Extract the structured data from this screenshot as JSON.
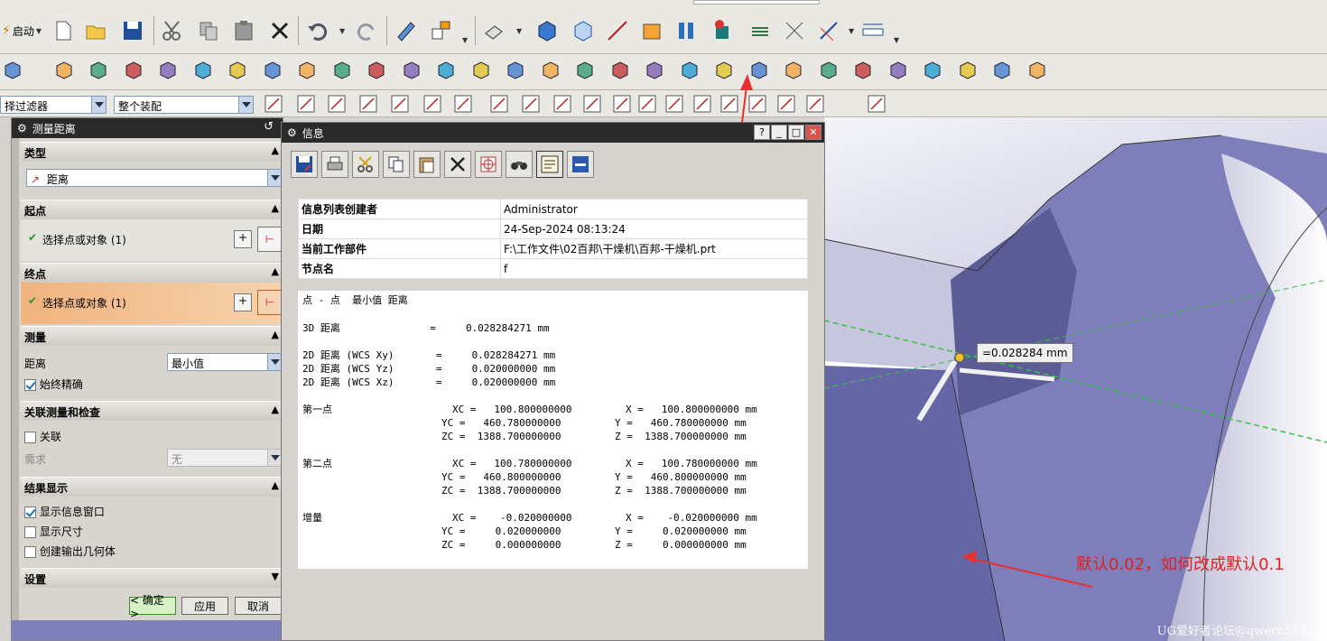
{
  "toolbar": {
    "start_label": "启动",
    "filter_label": "择过滤器",
    "assembly_label": "整个装配"
  },
  "measure_dialog": {
    "title": "测量距离",
    "type_section": "类型",
    "type_value": "距离",
    "start_section": "起点",
    "start_select": "选择点或对象 (1)",
    "end_section": "终点",
    "end_select": "选择点或对象 (1)",
    "measure_section": "测量",
    "distance_label": "距离",
    "distance_value": "最小值",
    "always_accurate": "始终精确",
    "assoc_section": "关联测量和检查",
    "assoc_label": "关联",
    "need_label": "需求",
    "need_value": "无",
    "result_section": "结果显示",
    "show_info": "显示信息窗口",
    "show_dims": "显示尺寸",
    "create_geo": "创建输出几何体",
    "settings_section": "设置",
    "ok_label": "< 确定 >",
    "apply_label": "应用",
    "cancel_label": "取消"
  },
  "info_window": {
    "title": "信息",
    "meta": [
      {
        "key": "信息列表创建者",
        "value": "Administrator"
      },
      {
        "key": "日期",
        "value": "24-Sep-2024 08:13:24"
      },
      {
        "key": "当前工作部件",
        "value": "F:\\工作文件\\02百邦\\干燥机\\百邦-干燥机.prt"
      },
      {
        "key": "节点名",
        "value": "f"
      }
    ],
    "report": {
      "heading": "点 - 点  最小值 距离",
      "d3": "3D 距离               =     0.028284271 mm",
      "d2xy": "2D 距离 (WCS Xy)       =     0.028284271 mm",
      "d2yz": "2D 距离 (WCS Yz)       =     0.020000000 mm",
      "d2xz": "2D 距离 (WCS Xz)       =     0.020000000 mm",
      "p1_label": "第一点",
      "p1_x": "XC =   100.800000000         X =   100.800000000 mm",
      "p1_y": "YC =   460.780000000         Y =   460.780000000 mm",
      "p1_z": "ZC =  1388.700000000         Z =  1388.700000000 mm",
      "p2_label": "第二点",
      "p2_x": "XC =   100.780000000         X =   100.780000000 mm",
      "p2_y": "YC =   460.800000000         Y =   460.800000000 mm",
      "p2_z": "ZC =  1388.700000000         Z =  1388.700000000 mm",
      "inc_label": "增量",
      "inc_x": "XC =    -0.020000000         X =    -0.020000000 mm",
      "inc_y": "YC =     0.020000000         Y =     0.020000000 mm",
      "inc_z": "ZC =     0.000000000         Z =     0.000000000 mm"
    }
  },
  "viewport": {
    "tooltip": "=0.028284 mm",
    "annotation": "默认0.02，如何改成默认0.1",
    "watermark": "UG爱好者论坛@qwer657454"
  },
  "colors": {
    "title_bar": "#2a2a2a",
    "annotation_red": "#e02020",
    "part_face": "#7e7fba",
    "highlight_row": "#f0b37e"
  }
}
